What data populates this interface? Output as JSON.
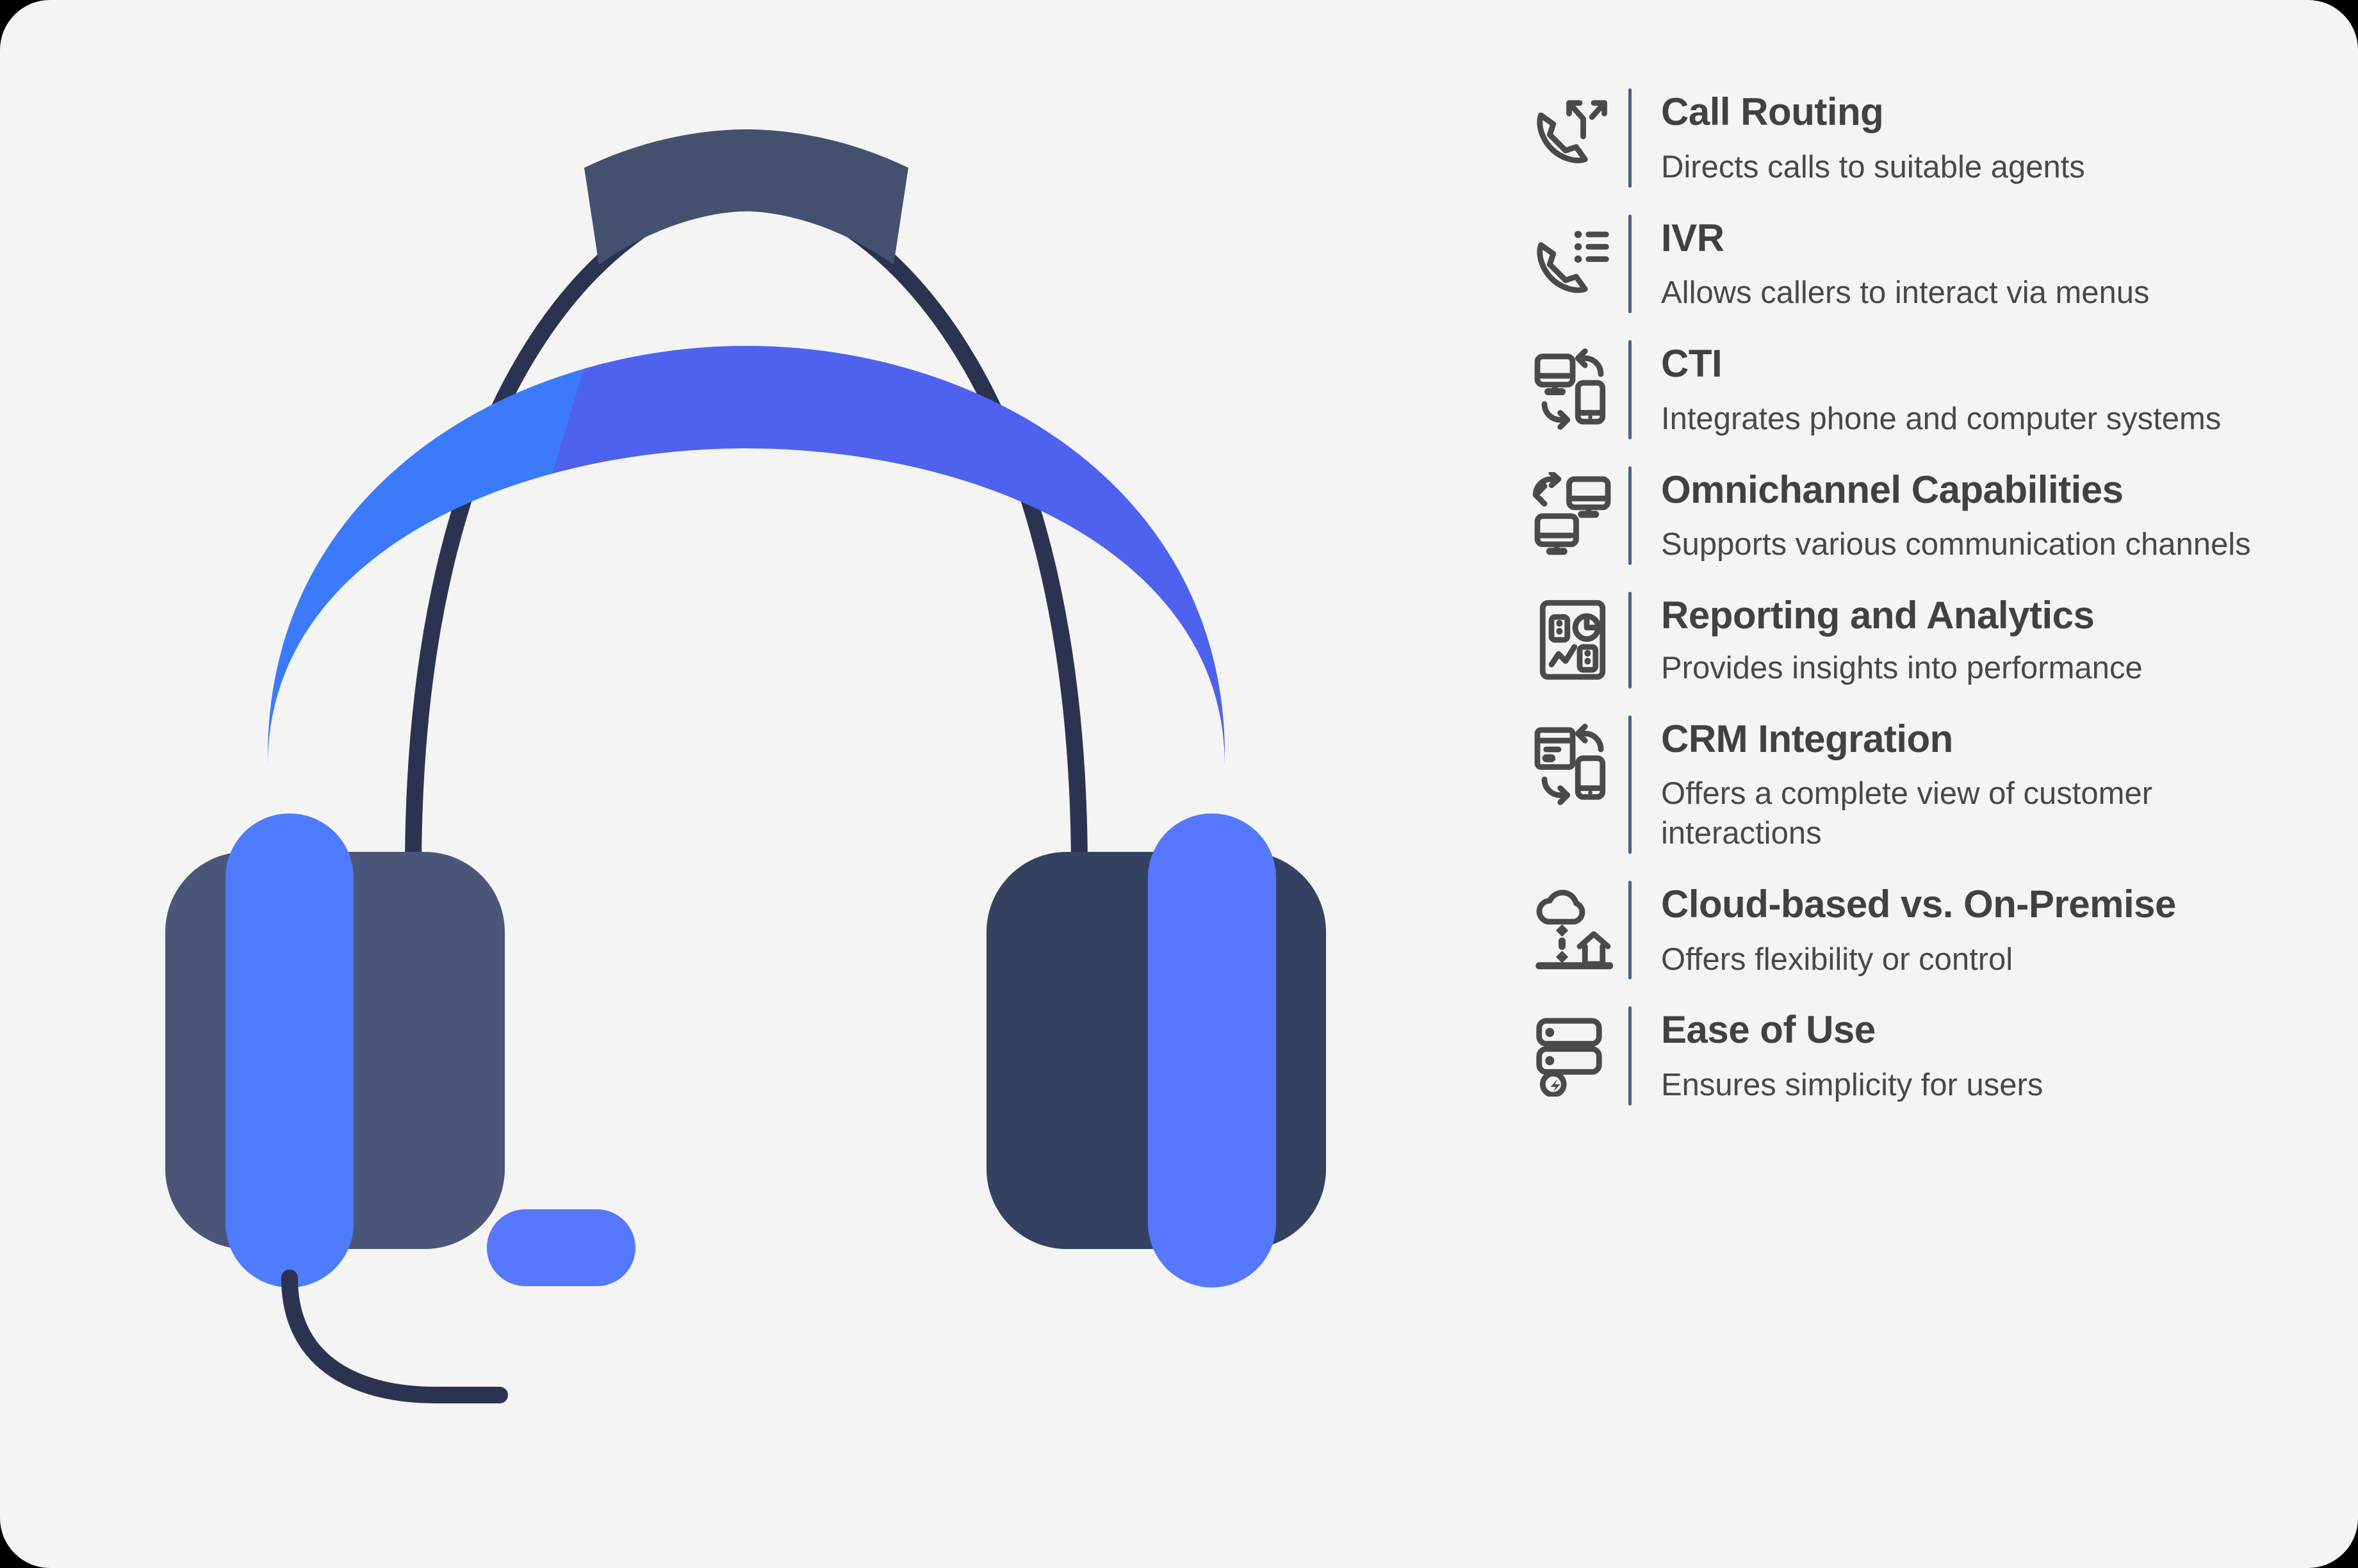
{
  "theme": {
    "background": "#f4f4f4",
    "title_color": "#414141",
    "desc_color": "#484848",
    "divider_color": "#4c6285",
    "icon_color": "#4a4a4a",
    "headset_band_light": "#3b7bfb",
    "headset_band_dark": "#4f62ee",
    "headset_arc": "#2b3350",
    "headset_top_cap": "#454f6e",
    "earcup_left": "#4b5578",
    "earcup_right": "#344160",
    "earpad": "#4f7bff",
    "mic_color": "#5578ff"
  },
  "illustration": {
    "name": "call-center-headset",
    "alt": "Blue and navy headset with boom microphone"
  },
  "features": [
    {
      "icon": "call-routing-icon",
      "title": "Call Routing",
      "desc": "Directs calls to suitable agents"
    },
    {
      "icon": "ivr-menu-icon",
      "title": "IVR",
      "desc": "Allows callers to interact via menus"
    },
    {
      "icon": "cti-computer-phone-icon",
      "title": "CTI",
      "desc": "Integrates phone and computer systems"
    },
    {
      "icon": "omnichannel-screens-icon",
      "title": "Omnichannel Capabilities",
      "desc": "Supports various communication channels"
    },
    {
      "icon": "reporting-analytics-icon",
      "title": "Reporting and Analytics",
      "desc": "Provides insights into performance"
    },
    {
      "icon": "crm-integration-icon",
      "title": "CRM Integration",
      "desc": "Offers a complete view of customer interactions"
    },
    {
      "icon": "cloud-vs-onpremise-icon",
      "title": "Cloud-based vs. On-Premise",
      "desc": "Offers flexibility or control"
    },
    {
      "icon": "ease-of-use-server-icon",
      "title": "Ease of Use",
      "desc": "Ensures simplicity for users"
    }
  ]
}
